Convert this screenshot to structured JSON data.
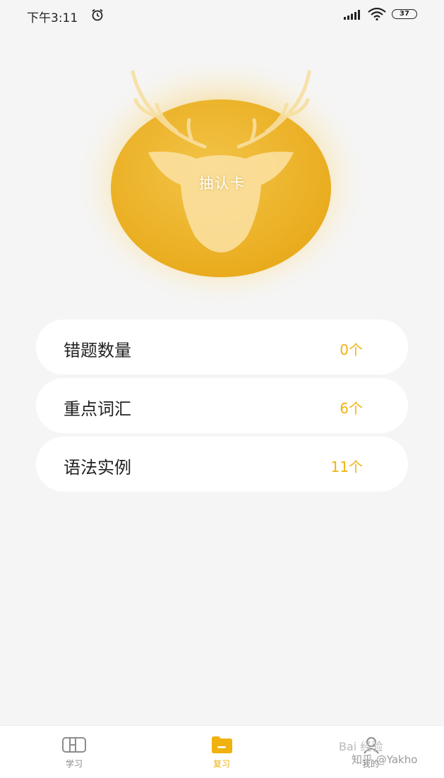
{
  "status_bar": {
    "time": "下午3:11",
    "battery": "37",
    "icons": [
      "alarm-icon",
      "signal-icon",
      "wifi-icon",
      "battery-icon"
    ]
  },
  "hero": {
    "label": "抽认卡",
    "icon": "deer-head-icon"
  },
  "cards": [
    {
      "label": "错题数量",
      "count": "0个"
    },
    {
      "label": "重点词汇",
      "count": "6个"
    },
    {
      "label": "语法实例",
      "count": "11个"
    }
  ],
  "tabs": [
    {
      "label": "学习",
      "icon": "book-icon",
      "active": false
    },
    {
      "label": "复习",
      "icon": "folder-icon",
      "active": true
    },
    {
      "label": "我的",
      "icon": "person-icon",
      "active": false
    }
  ],
  "watermark": {
    "line1": "Bai 经验",
    "line2": "知乎 @Yakho"
  },
  "colors": {
    "accent": "#f1b20f",
    "background": "#f5f5f5",
    "disc": "#eeb52d"
  }
}
